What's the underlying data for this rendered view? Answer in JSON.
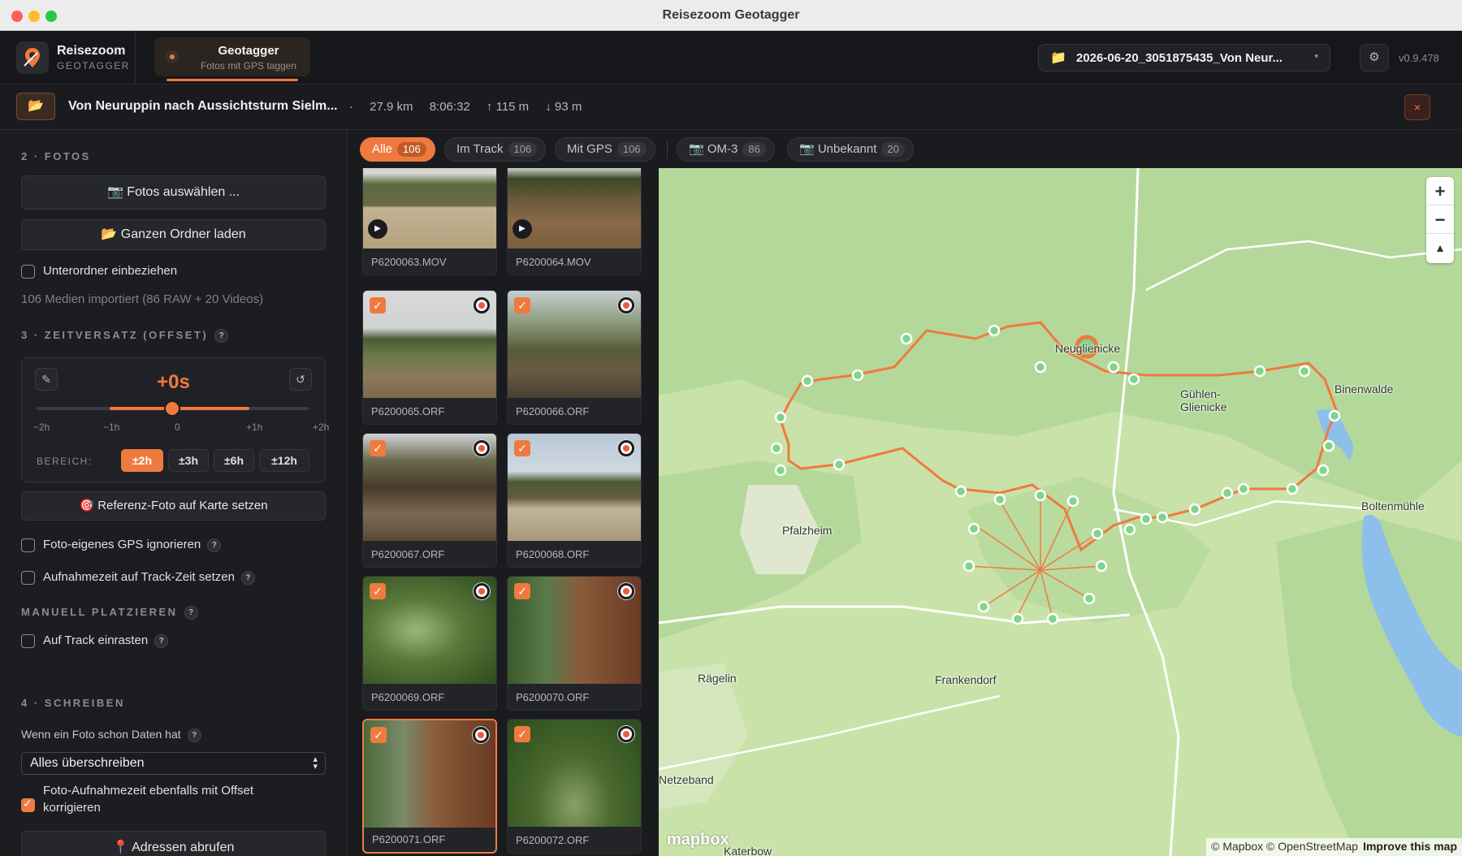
{
  "window": {
    "title": "Reisezoom Geotagger"
  },
  "brand": {
    "name": "Reisezoom",
    "sub": "GEOTAGGER"
  },
  "module_tab": {
    "title": "Geotagger",
    "subtitle": "Fotos mit GPS taggen"
  },
  "project": {
    "name": "2026-06-20_3051875435_Von Neur...",
    "icon": "folder-icon"
  },
  "version": "v0.9.478",
  "track": {
    "name": "Von Neuruppin nach Aussichtsturm Sielm...",
    "separator": "·",
    "distance": "27.9 km",
    "duration": "8:06:32",
    "ascent": "↑ 115 m",
    "descent": "↓ 93 m",
    "close_label": "×"
  },
  "sidebar": {
    "photos_header": "2 · FOTOS",
    "select_photos": "📷 Fotos auswählen ...",
    "load_folder": "📂 Ganzen Ordner laden",
    "include_subfolders": "Unterordner einbeziehen",
    "imported_summary": "106 Medien importiert (86 RAW + 20 Videos)",
    "offset_header": "3 · ZEITVERSATZ (OFFSET)",
    "offset_value": "+0s",
    "offset_value_seconds": 0,
    "ticks": [
      "−2h",
      "−1h",
      "0",
      "+1h",
      "+2h"
    ],
    "range_label": "BEREICH:",
    "ranges": [
      "±2h",
      "±3h",
      "±6h",
      "±12h"
    ],
    "active_range": "±2h",
    "reference_photo": "🎯 Referenz-Foto auf Karte setzen",
    "ignore_gps": "Foto-eigenes GPS ignorieren",
    "set_capture_time": "Aufnahmezeit auf Track-Zeit setzen",
    "manual_header": "MANUELL PLATZIEREN",
    "snap_track": "Auf Track einrasten",
    "write_header": "4 · SCHREIBEN",
    "existing_data_label": "Wenn ein Foto schon Daten hat",
    "overwrite_option": "Alles überschreiben",
    "correct_time": "Foto-Aufnahmezeit ebenfalls mit Offset korrigieren",
    "fetch_addresses": "📍 Adressen abrufen",
    "help": "?"
  },
  "filters": [
    {
      "label": "Alle",
      "count": "106",
      "active": true
    },
    {
      "label": "Im Track",
      "count": "106"
    },
    {
      "label": "Mit GPS",
      "count": "106"
    },
    {
      "label": "📷 OM-3",
      "count": "86"
    },
    {
      "label": "📷 Unbekannt",
      "count": "20"
    }
  ],
  "photos": [
    {
      "name": "P6200063.MOV",
      "video": true,
      "checked": false,
      "gps": false
    },
    {
      "name": "P6200064.MOV",
      "video": true,
      "checked": false,
      "gps": false
    },
    {
      "name": "P6200065.ORF",
      "checked": true,
      "gps": true
    },
    {
      "name": "P6200066.ORF",
      "checked": true,
      "gps": true
    },
    {
      "name": "P6200067.ORF",
      "checked": true,
      "gps": true
    },
    {
      "name": "P6200068.ORF",
      "checked": true,
      "gps": true
    },
    {
      "name": "P6200069.ORF",
      "checked": true,
      "gps": true
    },
    {
      "name": "P6200070.ORF",
      "checked": true,
      "gps": true
    },
    {
      "name": "P6200071.ORF",
      "checked": true,
      "gps": true,
      "selected": true
    },
    {
      "name": "P6200072.ORF",
      "checked": true,
      "gps": true
    }
  ],
  "map": {
    "labels": [
      "Neuglienicke",
      "Gühlen-Glienicke",
      "Binenwalde",
      "Boltenmühle",
      "Pfalzheim",
      "Rägelin",
      "Frankendorf",
      "Netzeband",
      "Katerbow"
    ],
    "zoom_in": "+",
    "zoom_out": "−",
    "compass": "▲",
    "attribution": "© Mapbox © OpenStreetMap",
    "improve": "Improve this map",
    "logo": "mapbox",
    "colors": {
      "track": "#ef7a3f",
      "land": "#c9e2a9",
      "forest": "#a9d18e",
      "water": "#8cc0ea",
      "marker": "#7fd58a"
    }
  },
  "colors": {
    "accent": "#ef7a3f",
    "bg": "#1a1b1f",
    "panel": "#1c1d21"
  }
}
